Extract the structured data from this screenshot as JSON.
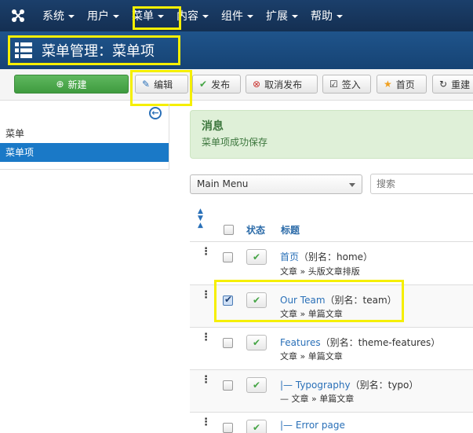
{
  "nav": {
    "items": [
      {
        "label": "系统"
      },
      {
        "label": "用户"
      },
      {
        "label": "菜单"
      },
      {
        "label": "内容"
      },
      {
        "label": "组件"
      },
      {
        "label": "扩展"
      },
      {
        "label": "帮助"
      }
    ]
  },
  "page": {
    "title": "菜单管理：菜单项"
  },
  "toolbar": {
    "new": "新建",
    "edit": "编辑",
    "publish": "发布",
    "unpublish": "取消发布",
    "checkin": "签入",
    "home": "首页",
    "rebuild": "重建"
  },
  "sidebar": {
    "items": [
      {
        "label": "菜单"
      },
      {
        "label": "菜单项"
      }
    ]
  },
  "message": {
    "heading": "消息",
    "body": "菜单项成功保存"
  },
  "filters": {
    "menu_select": "Main Menu",
    "search_placeholder": "搜索"
  },
  "table": {
    "headers": {
      "status": "状态",
      "title": "标题"
    },
    "rows": [
      {
        "title": "首页",
        "alias": "（别名：home）",
        "sub": "文章 » 头版文章排版",
        "checked": false
      },
      {
        "title": "Our Team",
        "alias": "（别名：team）",
        "sub": "文章 » 单篇文章",
        "checked": true
      },
      {
        "title": "Features",
        "alias": "（别名：theme-features）",
        "sub": "文章 » 单篇文章",
        "checked": false
      },
      {
        "title": "|— Typography",
        "alias": "（别名：typo）",
        "sub": "— 文章 » 单篇文章",
        "checked": false
      },
      {
        "title": "|— Error page",
        "alias": "",
        "sub": "",
        "checked": false
      }
    ]
  },
  "colors": {
    "nav_bg": "#17375e",
    "title_bg": "#1a4a7c",
    "highlight": "#f5ef00",
    "link": "#2a70b8",
    "success_bg": "#dff0d8",
    "new_button": "#4aa84a"
  }
}
